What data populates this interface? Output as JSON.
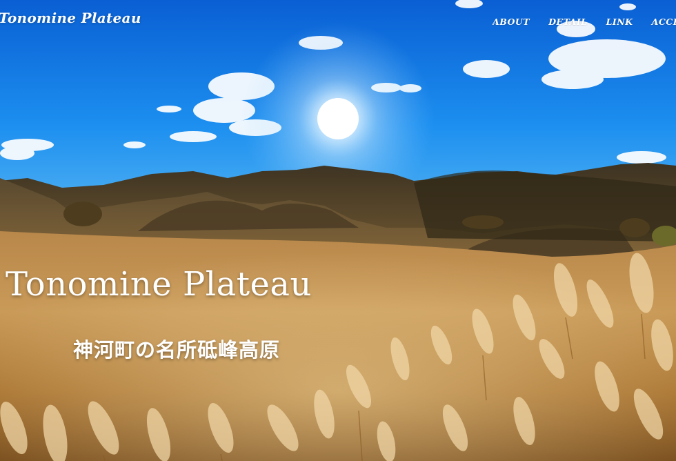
{
  "header": {
    "site_title": "Tonomine Plateau"
  },
  "nav": {
    "items": [
      {
        "label": "ABOUT"
      },
      {
        "label": "DETAIL"
      },
      {
        "label": "LINK"
      },
      {
        "label": "ACCESS"
      }
    ]
  },
  "hero": {
    "heading": "Tonomine Plateau",
    "subheading": "神河町の名所砥峰高原",
    "colors": {
      "sky_top": "#0b63d6",
      "sky_bottom": "#4fb0f2",
      "grass": "#c99a52",
      "mountains": "#4a3a22"
    }
  }
}
